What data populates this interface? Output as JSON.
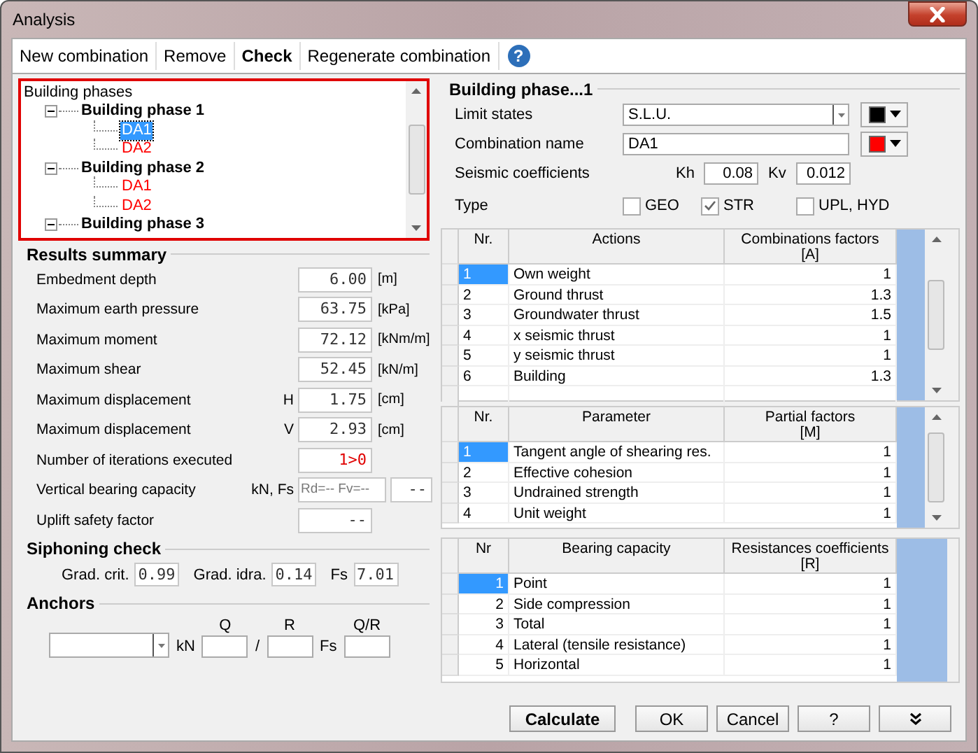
{
  "window": {
    "title": "Analysis"
  },
  "toolbar": [
    {
      "label": "New combination",
      "bold": false
    },
    {
      "label": "Remove",
      "bold": false
    },
    {
      "label": "Check",
      "bold": true
    },
    {
      "label": "Regenerate combination",
      "bold": false
    }
  ],
  "help": "?",
  "tree": {
    "label": "Building phases",
    "children": [
      {
        "label": "Building phase 1",
        "expanded": true,
        "children": [
          {
            "label": "DA1",
            "selected": true
          },
          {
            "label": "DA2",
            "color": "#ff0000",
            "selected": false
          }
        ]
      },
      {
        "label": "Building phase 2",
        "expanded": true,
        "children": [
          {
            "label": "DA1",
            "color": "#ff0000",
            "selected": false
          },
          {
            "label": "DA2",
            "color": "#ff0000",
            "selected": false
          }
        ]
      },
      {
        "label": "Building phase 3",
        "expanded": true
      }
    ]
  },
  "results": {
    "title": "Results summary",
    "rows": [
      {
        "label": "Embedment depth",
        "values": [
          "6.00"
        ],
        "unit": "[m]",
        "alert": false
      },
      {
        "label": "Maximum earth pressure",
        "values": [
          "63.75"
        ],
        "unit": "[kPa]",
        "alert": false
      },
      {
        "label": "Maximum moment",
        "values": [
          "72.12"
        ],
        "unit": "[kNm/m]",
        "alert": false
      },
      {
        "label": "Maximum shear",
        "values": [
          "52.45"
        ],
        "unit": "[kN/m]",
        "alert": false
      },
      {
        "label": "Maximum displacement",
        "qualifier": "H",
        "values": [
          "1.75"
        ],
        "unit": "[cm]",
        "alert": false
      },
      {
        "label": "Maximum displacement",
        "qualifier": "V",
        "values": [
          "2.93"
        ],
        "unit": "[cm]",
        "alert": false
      },
      {
        "label": "Number of iterations executed",
        "values": [
          "1>0"
        ],
        "alert": true
      },
      {
        "label": "Vertical bearing capacity",
        "qualifier": "kN, Fs",
        "values": [
          "Rd=-- Fv=--",
          "--"
        ],
        "alert": false
      },
      {
        "label": "Uplift safety factor",
        "values": [
          "--"
        ],
        "alert": false
      }
    ]
  },
  "siphoning": {
    "title": "Siphoning check",
    "items": [
      {
        "label": "Grad. crit.",
        "value": "0.99"
      },
      {
        "label": "Grad. idra.",
        "value": "0.14"
      },
      {
        "label": "Fs",
        "value": "7.01"
      }
    ]
  },
  "anchors": {
    "title": "Anchors",
    "unit": "kN",
    "q_label": "Q",
    "r_label": "R",
    "ratio_label": "Q/R",
    "divider": "/",
    "fs_label": "Fs"
  },
  "phase": {
    "title": "Building phase...1",
    "limit_states": {
      "label": "Limit states",
      "value": "S.L.U.",
      "color": "#000000"
    },
    "combination_name": {
      "label": "Combination name",
      "value": "DA1",
      "color": "#ff0000"
    },
    "seismic": {
      "label": "Seismic coefficients",
      "kh_label": "Kh",
      "kh": "0.08",
      "kv_label": "Kv",
      "kv": "0.012"
    },
    "type": {
      "label": "Type",
      "options": [
        {
          "label": "GEO",
          "checked": false
        },
        {
          "label": "STR",
          "checked": true
        },
        {
          "label": "UPL, HYD",
          "checked": false
        }
      ]
    }
  },
  "tables": [
    {
      "scrollable": true,
      "columns": [
        {
          "title": "Nr."
        },
        {
          "title": "Actions"
        },
        {
          "title": "Combinations factors",
          "subtitle": "[A]"
        }
      ],
      "rows": [
        {
          "nr": "1",
          "name": "Own weight",
          "value": "1",
          "selected": true
        },
        {
          "nr": "2",
          "name": "Ground thrust",
          "value": "1.3",
          "selected": false
        },
        {
          "nr": "3",
          "name": "Groundwater thrust",
          "value": "1.5",
          "selected": false
        },
        {
          "nr": "4",
          "name": "x seismic thrust",
          "value": "1",
          "selected": false
        },
        {
          "nr": "5",
          "name": "y seismic thrust",
          "value": "1",
          "selected": false
        },
        {
          "nr": "6",
          "name": "Building",
          "value": "1.3",
          "selected": false
        }
      ]
    },
    {
      "scrollable": true,
      "columns": [
        {
          "title": "Nr."
        },
        {
          "title": "Parameter"
        },
        {
          "title": "Partial factors",
          "subtitle": "[M]"
        }
      ],
      "rows": [
        {
          "nr": "1",
          "name": "Tangent angle of shearing res.",
          "value": "1",
          "selected": true
        },
        {
          "nr": "2",
          "name": "Effective cohesion",
          "value": "1",
          "selected": false
        },
        {
          "nr": "3",
          "name": "Undrained strength",
          "value": "1",
          "selected": false
        },
        {
          "nr": "4",
          "name": "Unit weight",
          "value": "1",
          "selected": false
        }
      ]
    },
    {
      "scrollable": false,
      "columns": [
        {
          "title": "Nr"
        },
        {
          "title": "Bearing capacity"
        },
        {
          "title": "Resistances coefficients",
          "subtitle": "[R]"
        }
      ],
      "rows": [
        {
          "nr": "1",
          "name": "Point",
          "value": "1",
          "selected": true
        },
        {
          "nr": "2",
          "name": "Side compression",
          "value": "1",
          "selected": false
        },
        {
          "nr": "3",
          "name": "Total",
          "value": "1",
          "selected": false
        },
        {
          "nr": "4",
          "name": "Lateral (tensile resistance)",
          "value": "1",
          "selected": false
        },
        {
          "nr": "5",
          "name": "Horizontal",
          "value": "1",
          "selected": false
        }
      ]
    }
  ],
  "buttons": [
    {
      "kind": "text",
      "label": "Calculate",
      "bold": true
    },
    {
      "kind": "text",
      "label": "OK",
      "bold": false
    },
    {
      "kind": "text",
      "label": "Cancel",
      "bold": false
    },
    {
      "kind": "text",
      "label": "?",
      "bold": false
    },
    {
      "kind": "icon"
    }
  ]
}
